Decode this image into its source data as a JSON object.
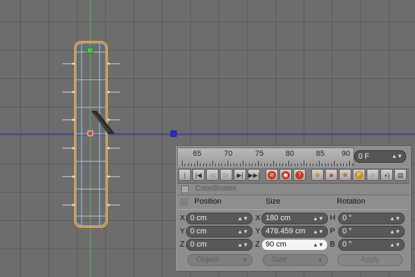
{
  "colors": {
    "viewport_bg": "#6d6d6d",
    "x_axis_line": "#1f1fd6",
    "y_axis_line": "#58b858",
    "object_outline": "#f0a030",
    "wire": "#a8c8e8"
  },
  "timeline": {
    "ticks": [
      "65",
      "70",
      "75",
      "80",
      "85",
      "90"
    ],
    "current_frame": "0 F"
  },
  "transport": {
    "buttons": [
      {
        "name": "go-to-start-icon",
        "glyph": "⏮"
      },
      {
        "name": "previous-key-icon",
        "glyph": "◀|"
      },
      {
        "name": "play-backward-icon",
        "glyph": "◁"
      },
      {
        "name": "play-forward-icon",
        "glyph": "▷"
      },
      {
        "name": "next-key-icon",
        "glyph": "|▶"
      },
      {
        "name": "go-to-end-icon",
        "glyph": "⏭"
      },
      {
        "name": "record-keys-icon",
        "glyph": "●"
      },
      {
        "name": "autokeying-icon",
        "glyph": "◉"
      },
      {
        "name": "help-icon",
        "glyph": "?"
      },
      {
        "name": "move-tool-icon",
        "glyph": "✥"
      },
      {
        "name": "scale-tool-icon",
        "glyph": "▣"
      },
      {
        "name": "rotate-tool-icon",
        "glyph": "⟳"
      },
      {
        "name": "parameter-icon",
        "glyph": "P"
      },
      {
        "name": "dots-grid-icon",
        "glyph": "⁘"
      },
      {
        "name": "sound-icon",
        "glyph": "🔈"
      },
      {
        "name": "document-icon",
        "glyph": "📄"
      }
    ]
  },
  "coordinates": {
    "title": "Coordinates",
    "columns": {
      "position": "Position",
      "size": "Size",
      "rotation": "Rotation"
    },
    "position": [
      {
        "axis": "X",
        "value": "0 cm"
      },
      {
        "axis": "Y",
        "value": "0 cm"
      },
      {
        "axis": "Z",
        "value": "0 cm"
      }
    ],
    "size": [
      {
        "axis": "X",
        "value": "180 cm"
      },
      {
        "axis": "Y",
        "value": "478.459 cm"
      },
      {
        "axis": "Z",
        "value": "90 cm"
      }
    ],
    "rotation": [
      {
        "axis": "H",
        "value": "0 °"
      },
      {
        "axis": "P",
        "value": "0 °"
      },
      {
        "axis": "B",
        "value": "0 °"
      }
    ],
    "mode_dropdown": "Object",
    "size_dropdown": "Size",
    "apply_label": "Apply"
  }
}
